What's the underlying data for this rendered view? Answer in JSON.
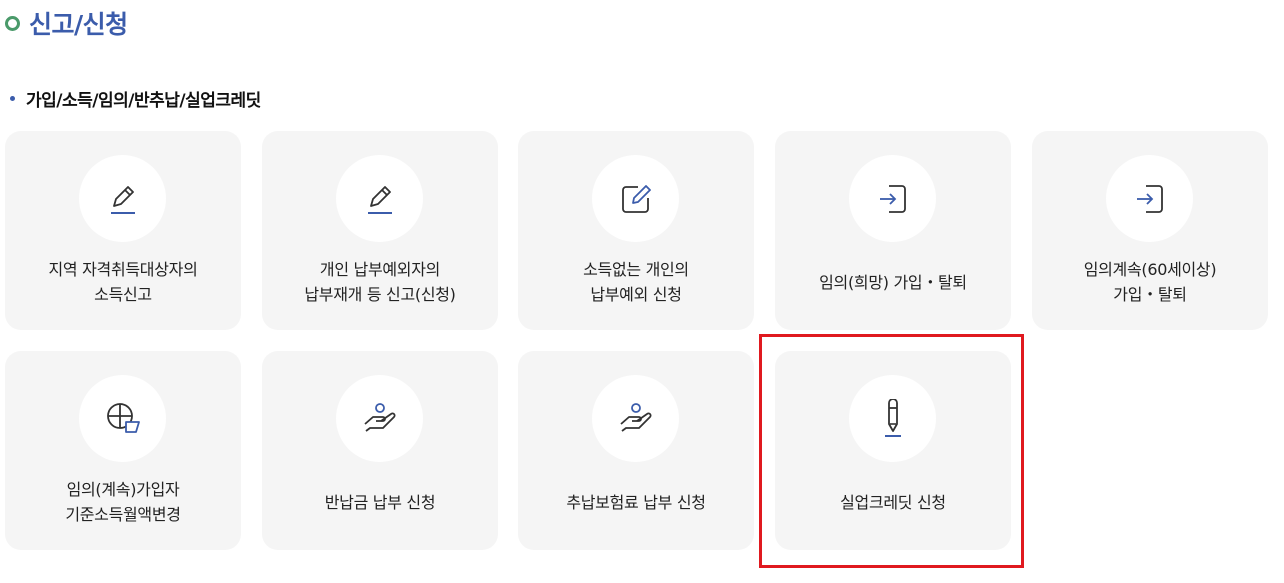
{
  "page": {
    "title": "신고/신청"
  },
  "section": {
    "title": "가입/소득/임의/반추납/실업크레딧"
  },
  "cards": [
    {
      "label": "지역 자격취득대상자의\n소득신고",
      "icon": "pencil-underline-icon"
    },
    {
      "label": "개인 납부예외자의\n납부재개 등 신고(신청)",
      "icon": "pencil-underline-icon"
    },
    {
      "label": "소득없는 개인의\n납부예외 신청",
      "icon": "edit-box-icon"
    },
    {
      "label": "임의(희망) 가입・탈퇴",
      "icon": "sign-in-icon"
    },
    {
      "label": "임의계속(60세이상)\n가입・탈퇴",
      "icon": "sign-in-icon"
    },
    {
      "label": "임의(계속)가입자\n기준소득월액변경",
      "icon": "pie-chart-icon"
    },
    {
      "label": "반납금 납부 신청",
      "icon": "hand-payment-icon"
    },
    {
      "label": "추납보험료 납부 신청",
      "icon": "hand-payment-icon"
    },
    {
      "label": "실업크레딧 신청",
      "icon": "pencil-icon"
    }
  ],
  "colors": {
    "accent": "#3b5cab",
    "highlight": "#e0191f",
    "card_bg": "#f5f5f5"
  }
}
